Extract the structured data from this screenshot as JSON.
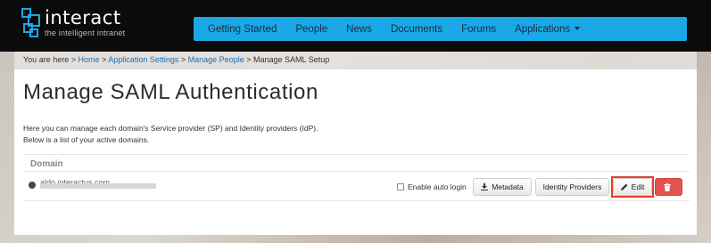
{
  "brand": {
    "name": "interact",
    "tagline": "the intelligent intranet"
  },
  "nav": {
    "items": [
      "Getting Started",
      "People",
      "News",
      "Documents",
      "Forums"
    ],
    "applications_label": "Applications"
  },
  "breadcrumb": {
    "prefix": "You are here >",
    "home": "Home",
    "sep1": ">",
    "app_settings": "Application Settings",
    "sep2": ">",
    "manage_people": "Manage People",
    "sep3": ">",
    "current": "Manage SAML Setup"
  },
  "page": {
    "title": "Manage SAML Authentication",
    "desc_line1": "Here you can manage each domain's Service provider (SP) and Identity providers (IdP).",
    "desc_line2": "Below is a list of your active domains."
  },
  "table": {
    "header": "Domain",
    "rows": [
      {
        "domain": "aldo.interactus.com",
        "auto_login_label": "Enable auto login",
        "auto_login_checked": false,
        "metadata_label": "Metadata",
        "idp_label": "Identity Providers",
        "edit_label": "Edit"
      }
    ]
  },
  "colors": {
    "nav_bg": "#1aa9e6",
    "link": "#1a6fb5",
    "highlight": "#e0412b",
    "delete": "#e2524e"
  }
}
